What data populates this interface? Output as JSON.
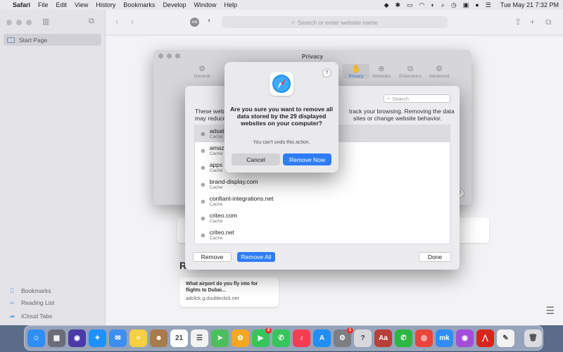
{
  "menubar": {
    "app": "Safari",
    "items": [
      "File",
      "Edit",
      "View",
      "History",
      "Bookmarks",
      "Develop",
      "Window",
      "Help"
    ],
    "clock": "Tue May 21  7:32 PM"
  },
  "sidebar": {
    "start_page": "Start Page",
    "bookmarks": "Bookmarks",
    "reading_list": "Reading List",
    "icloud_tabs": "iCloud Tabs"
  },
  "toolbar": {
    "url_placeholder": "Search or enter website name",
    "extension_badge": "mk"
  },
  "start_page": {
    "reading_list_heading": "R",
    "reading_card_title": "What airport do you fly into for flights to Dubai...",
    "reading_card_url": "adclick.g.doubleclick.net"
  },
  "preferences": {
    "title": "Privacy",
    "tabs": [
      "General",
      "Tabs",
      "AutoFill",
      "Passwords",
      "Search",
      "Security",
      "Privacy",
      "Websites",
      "Extensions",
      "Advanced"
    ],
    "active_tab": "Privacy",
    "help": "?"
  },
  "website_data": {
    "search_placeholder": "Search",
    "description_left_1": "These webs",
    "description_right_1": "track your browsing. Removing the data",
    "description_left_2": "may reduce",
    "description_right_2": "sites or change website behavior.",
    "sites": [
      {
        "name": "adsat",
        "type": "Cache",
        "selected": true
      },
      {
        "name": "amaz",
        "type": "Cache",
        "selected": false
      },
      {
        "name": "apps",
        "type": "Cache",
        "selected": false
      },
      {
        "name": "brand-display.com",
        "type": "Cache",
        "selected": false
      },
      {
        "name": "confiant-integrations.net",
        "type": "Cache",
        "selected": false
      },
      {
        "name": "criteo.com",
        "type": "Cache",
        "selected": false
      },
      {
        "name": "criteo.net",
        "type": "Cache",
        "selected": false
      }
    ],
    "remove_button": "Remove",
    "remove_all_button": "Remove All",
    "done_button": "Done"
  },
  "alert": {
    "title": "Are you sure you want to remove all data stored by the 29 displayed websites on your computer?",
    "subtitle": "You can't undo this action.",
    "cancel_button": "Cancel",
    "confirm_button": "Remove Now",
    "help": "?"
  },
  "dock": {
    "apps": [
      {
        "name": "finder-icon",
        "color": "#2f8df5",
        "glyph": "☺"
      },
      {
        "name": "launchpad-icon",
        "color": "#6c6c78",
        "glyph": "▦"
      },
      {
        "name": "siri-icon",
        "color": "#4b3aa8",
        "glyph": "◉"
      },
      {
        "name": "safari-icon",
        "color": "#1e90ff",
        "glyph": "✦"
      },
      {
        "name": "mail-icon",
        "color": "#3d8ef0",
        "glyph": "✉"
      },
      {
        "name": "notes-icon",
        "color": "#f6cf43",
        "glyph": "≡"
      },
      {
        "name": "contacts-icon",
        "color": "#a87a4c",
        "glyph": "☻"
      },
      {
        "name": "calendar-icon",
        "color": "#ffffff",
        "glyph": "21"
      },
      {
        "name": "reminders-icon",
        "color": "#f2f2f2",
        "glyph": "☰"
      },
      {
        "name": "maps-icon",
        "color": "#4cbf5d",
        "glyph": "➤"
      },
      {
        "name": "photos-icon",
        "color": "#f5a623",
        "glyph": "✿"
      },
      {
        "name": "facetime-icon",
        "color": "#36c55a",
        "glyph": "▶",
        "badge": "2"
      },
      {
        "name": "messages-icon",
        "color": "#36c55a",
        "glyph": "✆"
      },
      {
        "name": "music-icon",
        "color": "#f43d52",
        "glyph": "♪"
      },
      {
        "name": "app-store-icon",
        "color": "#1e8ff3",
        "glyph": "A"
      },
      {
        "name": "system-preferences-icon",
        "color": "#7d7d82",
        "glyph": "⚙",
        "badge": "1"
      },
      {
        "name": "help-icon",
        "color": "#d8d8dc",
        "glyph": "?"
      },
      {
        "name": "dictionary-icon",
        "color": "#b7403b",
        "glyph": "Aa"
      },
      {
        "name": "whatsapp-icon",
        "color": "#2bb741",
        "glyph": "✆"
      },
      {
        "name": "chrome-icon",
        "color": "#e8453c",
        "glyph": "◎"
      },
      {
        "name": "mk-icon",
        "color": "#2f8df5",
        "glyph": "mk"
      },
      {
        "name": "podcasts-icon",
        "color": "#a34ed9",
        "glyph": "◉"
      },
      {
        "name": "acrobat-icon",
        "color": "#d8261c",
        "glyph": "⋀"
      },
      {
        "name": "textedit-icon",
        "color": "#f2f2f2",
        "glyph": "✎"
      },
      {
        "name": "trash-icon",
        "color": "#dcdce0",
        "glyph": "🗑"
      }
    ]
  }
}
